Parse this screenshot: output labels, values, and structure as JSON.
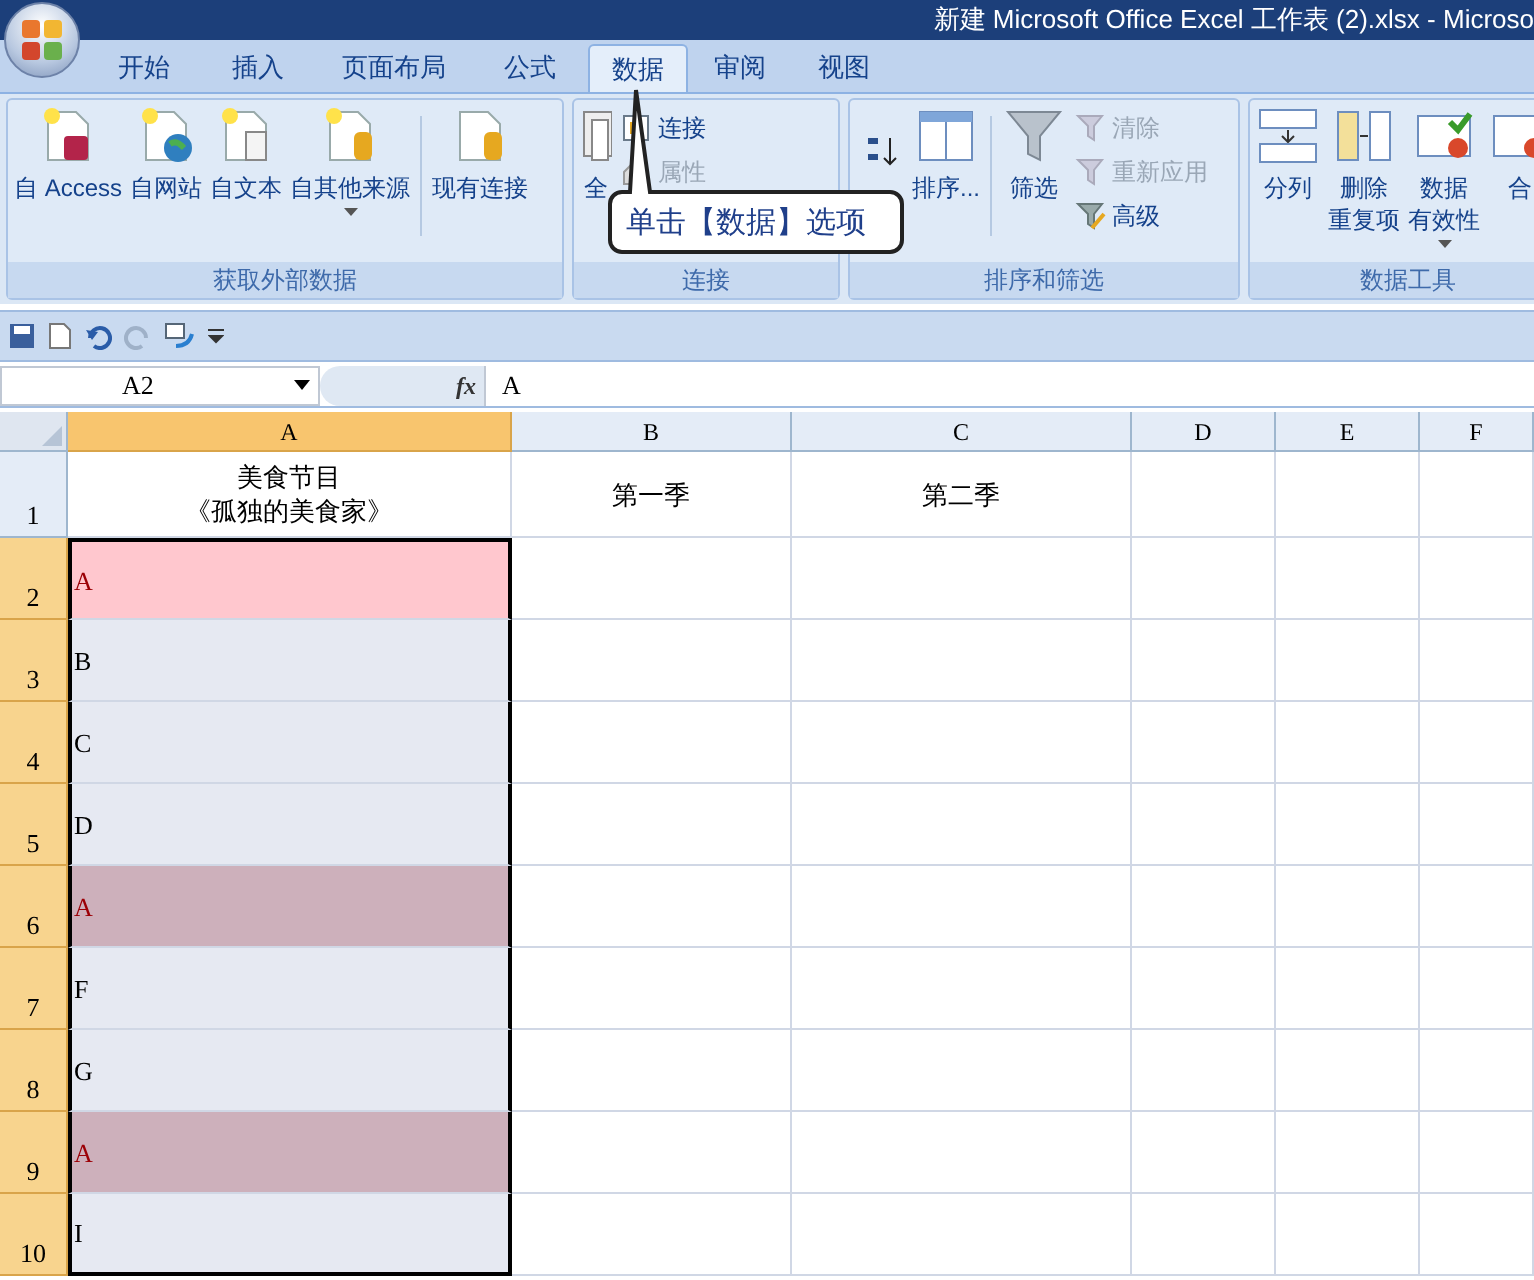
{
  "window": {
    "title": "新建 Microsoft Office Excel 工作表 (2).xlsx - Microso"
  },
  "tabs": [
    {
      "label": "开始",
      "selected": false
    },
    {
      "label": "插入",
      "selected": false
    },
    {
      "label": "页面布局",
      "selected": false
    },
    {
      "label": "公式",
      "selected": false
    },
    {
      "label": "数据",
      "selected": true
    },
    {
      "label": "审阅",
      "selected": false
    },
    {
      "label": "视图",
      "selected": false
    }
  ],
  "ribbon": {
    "groups": [
      {
        "label": "获取外部数据",
        "items": [
          {
            "lines": [
              "自 Access"
            ],
            "kind": "large",
            "disabled": false,
            "dropdown": false
          },
          {
            "lines": [
              "自网站"
            ],
            "kind": "large",
            "disabled": false,
            "dropdown": false
          },
          {
            "lines": [
              "自文本"
            ],
            "kind": "large",
            "disabled": false,
            "dropdown": false
          },
          {
            "lines": [
              "自其他来源"
            ],
            "kind": "large",
            "disabled": false,
            "dropdown": true
          },
          {
            "kind": "separator"
          },
          {
            "lines": [
              "现有连接"
            ],
            "kind": "large",
            "disabled": false,
            "dropdown": false
          }
        ]
      },
      {
        "label": "连接",
        "items": [
          {
            "lines": [
              "全"
            ],
            "kind": "large",
            "disabled": false,
            "dropdown": false
          },
          {
            "lines": [
              "连接"
            ],
            "kind": "small",
            "disabled": false,
            "dropdown": false
          },
          {
            "lines": [
              "属性"
            ],
            "kind": "small",
            "disabled": true,
            "dropdown": false
          }
        ]
      },
      {
        "label": "排序和筛选",
        "items": [
          {
            "kind": "sort_icon"
          },
          {
            "lines": [
              "排序..."
            ],
            "kind": "large",
            "disabled": false,
            "dropdown": false
          },
          {
            "kind": "separator"
          },
          {
            "lines": [
              "筛选"
            ],
            "kind": "large",
            "disabled": false,
            "dropdown": false
          },
          {
            "lines": [
              "清除"
            ],
            "kind": "small",
            "disabled": true,
            "dropdown": false
          },
          {
            "lines": [
              "重新应用"
            ],
            "kind": "small",
            "disabled": true,
            "dropdown": false
          },
          {
            "lines": [
              "高级"
            ],
            "kind": "small",
            "disabled": false,
            "dropdown": false
          }
        ]
      },
      {
        "label": "数据工具",
        "items": [
          {
            "lines": [
              "分列"
            ],
            "kind": "large",
            "disabled": false,
            "dropdown": false
          },
          {
            "lines": [
              "删除",
              "重复项"
            ],
            "kind": "large",
            "disabled": false,
            "dropdown": false
          },
          {
            "lines": [
              "数据",
              "有效性"
            ],
            "kind": "large",
            "disabled": false,
            "dropdown": true
          },
          {
            "lines": [
              "合"
            ],
            "kind": "large",
            "disabled": false,
            "dropdown": false
          }
        ]
      }
    ]
  },
  "callout": {
    "text": "单击【数据】选项"
  },
  "name_box": {
    "value": "A2"
  },
  "formula_bar": {
    "function_label": "fx",
    "value": "A"
  },
  "sheet": {
    "columns": [
      {
        "label": "A",
        "selected": true
      },
      {
        "label": "B",
        "selected": false
      },
      {
        "label": "C",
        "selected": false
      },
      {
        "label": "D",
        "selected": false
      },
      {
        "label": "E",
        "selected": false
      },
      {
        "label": "F",
        "selected": false
      }
    ],
    "rows": [
      {
        "number": "1",
        "cells": [
          [
            "美食节目",
            "《孤独的美食家》"
          ],
          [
            "第一季"
          ],
          [
            "第二季"
          ]
        ],
        "selected": false,
        "highlighted": false,
        "active": false
      },
      {
        "number": "2",
        "cells": [
          [
            "A"
          ]
        ],
        "selected": true,
        "highlighted": true,
        "active": true
      },
      {
        "number": "3",
        "cells": [
          [
            "B"
          ]
        ],
        "selected": true,
        "highlighted": false,
        "active": false
      },
      {
        "number": "4",
        "cells": [
          [
            "C"
          ]
        ],
        "selected": true,
        "highlighted": false,
        "active": false
      },
      {
        "number": "5",
        "cells": [
          [
            "D"
          ]
        ],
        "selected": true,
        "highlighted": false,
        "active": false
      },
      {
        "number": "6",
        "cells": [
          [
            "A"
          ]
        ],
        "selected": true,
        "highlighted": true,
        "active": false
      },
      {
        "number": "7",
        "cells": [
          [
            "F"
          ]
        ],
        "selected": true,
        "highlighted": false,
        "active": false
      },
      {
        "number": "8",
        "cells": [
          [
            "G"
          ]
        ],
        "selected": true,
        "highlighted": false,
        "active": false
      },
      {
        "number": "9",
        "cells": [
          [
            "A"
          ]
        ],
        "selected": true,
        "highlighted": true,
        "active": false
      },
      {
        "number": "10",
        "cells": [
          [
            "I"
          ]
        ],
        "selected": true,
        "highlighted": false,
        "active": false
      }
    ]
  }
}
